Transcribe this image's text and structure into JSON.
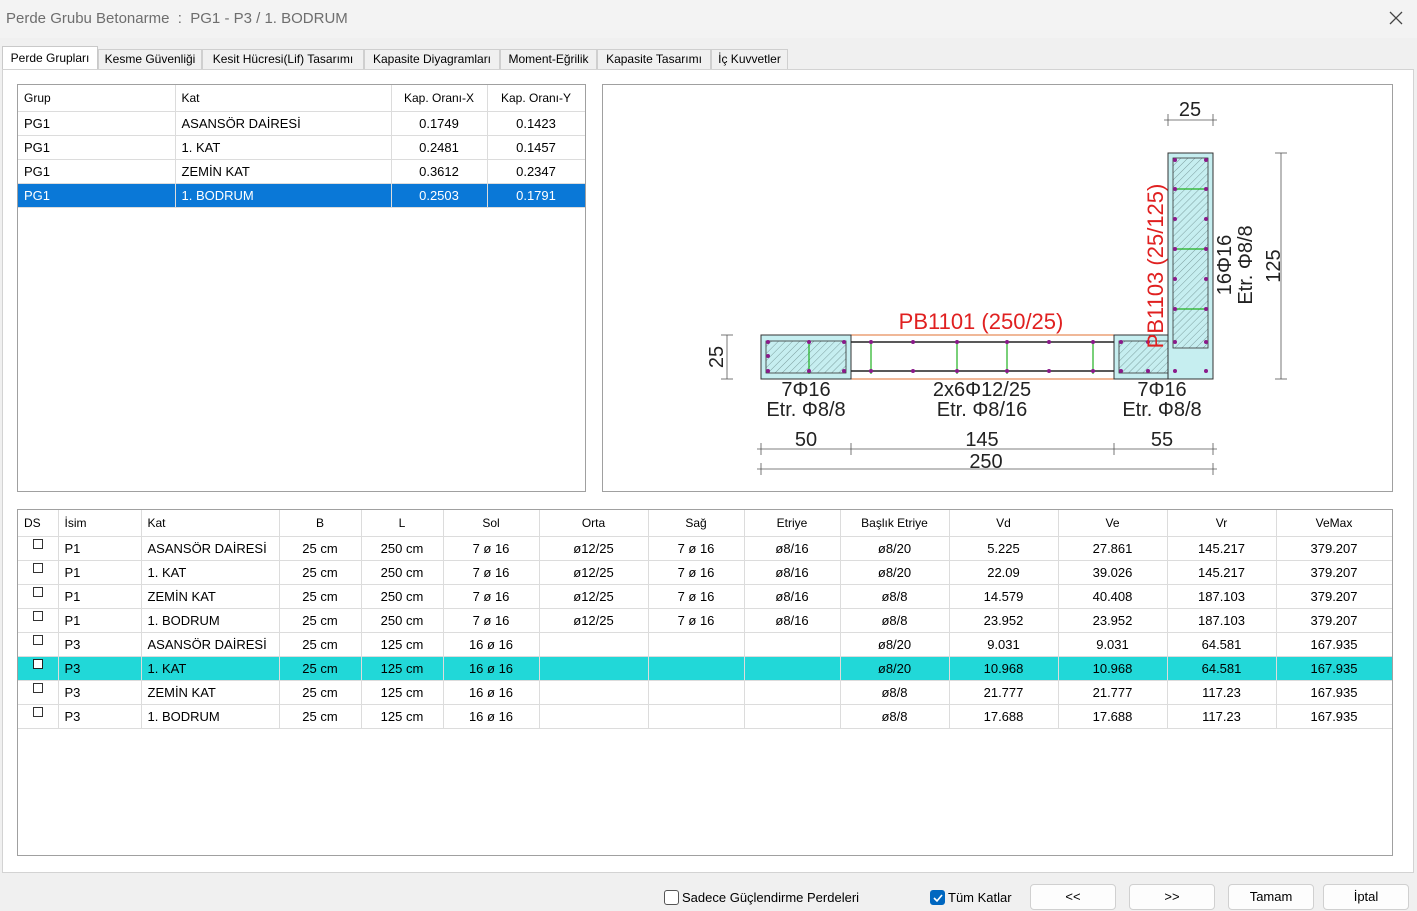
{
  "window": {
    "title": "Perde Grubu Betonarme  :  PG1 - P3 / 1. BODRUM"
  },
  "tabs": [
    {
      "label": "Perde Grupları"
    },
    {
      "label": "Kesme Güvenliği"
    },
    {
      "label": "Kesit Hücresi(Lif) Tasarımı"
    },
    {
      "label": "Kapasite Diyagramları"
    },
    {
      "label": "Moment-Eğrilik"
    },
    {
      "label": "Kapasite Tasarımı"
    },
    {
      "label": "İç Kuvvetler"
    }
  ],
  "groups": {
    "columns": [
      "Grup",
      "Kat",
      "Kap. Oranı-X",
      "Kap. Oranı-Y"
    ],
    "rows": [
      {
        "grup": "PG1",
        "kat": "ASANSÖR DAİRESİ",
        "x": "0.1749",
        "y": "0.1423"
      },
      {
        "grup": "PG1",
        "kat": "1. KAT",
        "x": "0.2481",
        "y": "0.1457"
      },
      {
        "grup": "PG1",
        "kat": "ZEMİN KAT",
        "x": "0.3612",
        "y": "0.2347"
      },
      {
        "grup": "PG1",
        "kat": "1. BODRUM",
        "x": "0.2503",
        "y": "0.1791"
      }
    ],
    "selected_index": 3
  },
  "section": {
    "dim_top": "25",
    "dim_left": "25",
    "dim_right": "125",
    "label_horizontal": "PB1101 (250/25)",
    "label_vertical": "PB1103 (25/125)",
    "label_color": "#e02020",
    "vertical_rebar": "16Φ16",
    "vertical_stirrup": "Etr. Φ8/8",
    "left_rebar": "7Φ16",
    "left_stirrup": "Etr. Φ8/8",
    "mid_rebar": "2x6Φ12/25",
    "mid_stirrup": "Etr. Φ8/16",
    "right_rebar": "7Φ16",
    "right_stirrup": "Etr. Φ8/8",
    "dim_b1": "50",
    "dim_b2": "145",
    "dim_b3": "55",
    "dim_total": "250"
  },
  "walls": {
    "columns": [
      "DS",
      "İsim",
      "Kat",
      "B",
      "L",
      "Sol",
      "Orta",
      "Sağ",
      "Etriye",
      "Başlık Etriye",
      "Vd",
      "Ve",
      "Vr",
      "VeMax"
    ],
    "rows": [
      {
        "isim": "P1",
        "kat": "ASANSÖR DAİRESİ",
        "b": "25 cm",
        "l": "250 cm",
        "sol": "7 ø 16",
        "orta": "ø12/25",
        "sag": "7 ø 16",
        "etriye": "ø8/16",
        "baslik": "ø8/20",
        "vd": "5.225",
        "ve": "27.861",
        "vr": "145.217",
        "vemax": "379.207"
      },
      {
        "isim": "P1",
        "kat": "1. KAT",
        "b": "25 cm",
        "l": "250 cm",
        "sol": "7 ø 16",
        "orta": "ø12/25",
        "sag": "7 ø 16",
        "etriye": "ø8/16",
        "baslik": "ø8/20",
        "vd": "22.09",
        "ve": "39.026",
        "vr": "145.217",
        "vemax": "379.207"
      },
      {
        "isim": "P1",
        "kat": "ZEMİN KAT",
        "b": "25 cm",
        "l": "250 cm",
        "sol": "7 ø 16",
        "orta": "ø12/25",
        "sag": "7 ø 16",
        "etriye": "ø8/16",
        "baslik": "ø8/8",
        "vd": "14.579",
        "ve": "40.408",
        "vr": "187.103",
        "vemax": "379.207"
      },
      {
        "isim": "P1",
        "kat": "1. BODRUM",
        "b": "25 cm",
        "l": "250 cm",
        "sol": "7 ø 16",
        "orta": "ø12/25",
        "sag": "7 ø 16",
        "etriye": "ø8/16",
        "baslik": "ø8/8",
        "vd": "23.952",
        "ve": "23.952",
        "vr": "187.103",
        "vemax": "379.207"
      },
      {
        "isim": "P3",
        "kat": "ASANSÖR DAİRESİ",
        "b": "25 cm",
        "l": "125 cm",
        "sol": "16 ø 16",
        "orta": "",
        "sag": "",
        "etriye": "",
        "baslik": "ø8/20",
        "vd": "9.031",
        "ve": "9.031",
        "vr": "64.581",
        "vemax": "167.935"
      },
      {
        "isim": "P3",
        "kat": "1. KAT",
        "b": "25 cm",
        "l": "125 cm",
        "sol": "16 ø 16",
        "orta": "",
        "sag": "",
        "etriye": "",
        "baslik": "ø8/20",
        "vd": "10.968",
        "ve": "10.968",
        "vr": "64.581",
        "vemax": "167.935"
      },
      {
        "isim": "P3",
        "kat": "ZEMİN KAT",
        "b": "25 cm",
        "l": "125 cm",
        "sol": "16 ø 16",
        "orta": "",
        "sag": "",
        "etriye": "",
        "baslik": "ø8/8",
        "vd": "21.777",
        "ve": "21.777",
        "vr": "117.23",
        "vemax": "167.935"
      },
      {
        "isim": "P3",
        "kat": "1. BODRUM",
        "b": "25 cm",
        "l": "125 cm",
        "sol": "16 ø 16",
        "orta": "",
        "sag": "",
        "etriye": "",
        "baslik": "ø8/8",
        "vd": "17.688",
        "ve": "17.688",
        "vr": "117.23",
        "vemax": "167.935"
      }
    ],
    "highlighted_index": 5,
    "highlight_color": "#21d8d8"
  },
  "footer": {
    "only_strengthening_label": "Sadece Güçlendirme Perdeleri",
    "only_strengthening_checked": false,
    "all_floors_label": "Tüm Katlar",
    "all_floors_checked": true,
    "prev_label": "<<",
    "next_label": ">>",
    "ok_label": "Tamam",
    "cancel_label": "İptal"
  },
  "colors": {
    "selection": "#0a78d7",
    "accent": "#0067c0"
  }
}
